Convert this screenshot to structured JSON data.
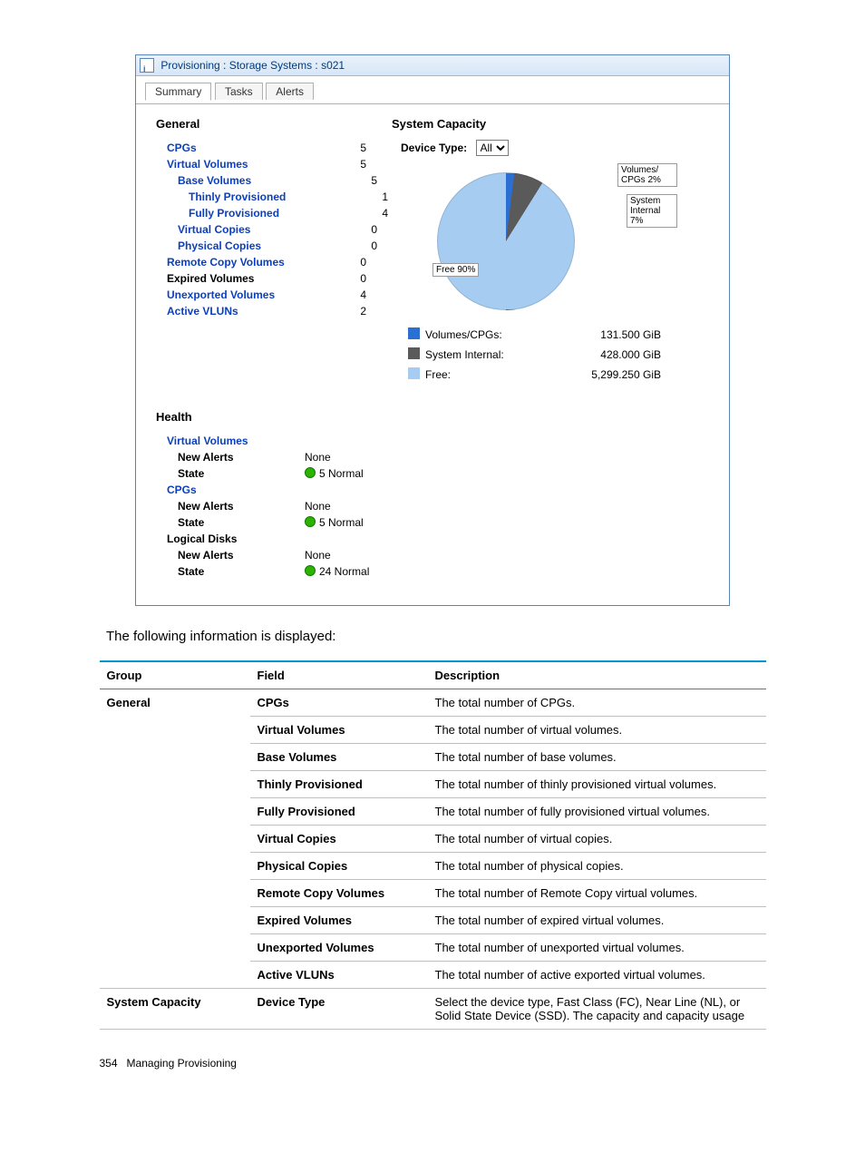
{
  "window": {
    "title": "Provisioning : Storage Systems : s021",
    "tabs": [
      "Summary",
      "Tasks",
      "Alerts"
    ],
    "active_tab": 0
  },
  "general": {
    "header": "General",
    "rows": [
      {
        "key": "cpgs",
        "label": "CPGs",
        "value": "5",
        "link": true,
        "indent": 0
      },
      {
        "key": "vv",
        "label": "Virtual Volumes",
        "value": "5",
        "link": true,
        "indent": 0
      },
      {
        "key": "bv",
        "label": "Base Volumes",
        "value": "5",
        "link": true,
        "indent": 1
      },
      {
        "key": "tp",
        "label": "Thinly Provisioned",
        "value": "1",
        "link": true,
        "indent": 2
      },
      {
        "key": "fp",
        "label": "Fully Provisioned",
        "value": "4",
        "link": true,
        "indent": 2
      },
      {
        "key": "vc",
        "label": "Virtual Copies",
        "value": "0",
        "link": true,
        "indent": 1
      },
      {
        "key": "pc",
        "label": "Physical Copies",
        "value": "0",
        "link": true,
        "indent": 1
      },
      {
        "key": "rcv",
        "label": "Remote Copy Volumes",
        "value": "0",
        "link": true,
        "indent": 0
      },
      {
        "key": "ev",
        "label": "Expired Volumes",
        "value": "0",
        "link": false,
        "indent": 0
      },
      {
        "key": "uv",
        "label": "Unexported Volumes",
        "value": "4",
        "link": true,
        "indent": 0
      },
      {
        "key": "av",
        "label": "Active VLUNs",
        "value": "2",
        "link": true,
        "indent": 0
      }
    ]
  },
  "capacity": {
    "header": "System Capacity",
    "device_type_label": "Device Type:",
    "device_type_value": "All",
    "callouts": {
      "free": "Free 90%",
      "volumes": "Volumes/\nCPGs 2%",
      "system": "System\nInternal\n7%"
    },
    "legend": [
      {
        "label": "Volumes/CPGs:",
        "value": "131.500 GiB",
        "sw": "sw-blue"
      },
      {
        "label": "System Internal:",
        "value": "428.000 GiB",
        "sw": "sw-gray"
      },
      {
        "label": "Free:",
        "value": "5,299.250 GiB",
        "sw": "sw-lblue"
      }
    ]
  },
  "chart_data": {
    "type": "pie",
    "title": "System Capacity",
    "slices": [
      {
        "name": "Volumes/CPGs",
        "percent": 2,
        "gib": 131.5
      },
      {
        "name": "System Internal",
        "percent": 7,
        "gib": 428.0
      },
      {
        "name": "Free",
        "percent": 90,
        "gib": 5299.25
      }
    ]
  },
  "health": {
    "header": "Health",
    "groups": [
      {
        "name": "Virtual Volumes",
        "link": true,
        "alerts": "None",
        "state": "5 Normal"
      },
      {
        "name": "CPGs",
        "link": true,
        "alerts": "None",
        "state": "5 Normal"
      },
      {
        "name": "Logical Disks",
        "link": false,
        "alerts": "None",
        "state": "24 Normal"
      }
    ],
    "labels": {
      "new_alerts": "New Alerts",
      "state": "State"
    }
  },
  "caption": "The following information is displayed:",
  "doc_headers": {
    "group": "Group",
    "field": "Field",
    "desc": "Description"
  },
  "doc_rows": [
    {
      "group": "General",
      "field": "CPGs",
      "desc": "The total number of CPGs."
    },
    {
      "group": "",
      "field": "Virtual Volumes",
      "desc": "The total number of virtual volumes."
    },
    {
      "group": "",
      "field": "Base Volumes",
      "desc": "The total number of base volumes."
    },
    {
      "group": "",
      "field": "Thinly Provisioned",
      "desc": "The total number of thinly provisioned virtual volumes."
    },
    {
      "group": "",
      "field": "Fully Provisioned",
      "desc": "The total number of fully provisioned virtual volumes."
    },
    {
      "group": "",
      "field": "Virtual Copies",
      "desc": "The total number of virtual copies."
    },
    {
      "group": "",
      "field": "Physical Copies",
      "desc": "The total number of physical copies."
    },
    {
      "group": "",
      "field": "Remote Copy Volumes",
      "desc": "The total number of Remote Copy virtual volumes."
    },
    {
      "group": "",
      "field": "Expired Volumes",
      "desc": "The total number of expired virtual volumes."
    },
    {
      "group": "",
      "field": "Unexported Volumes",
      "desc": "The total number of unexported virtual volumes."
    },
    {
      "group": "",
      "field": "Active VLUNs",
      "desc": "The total number of active exported virtual volumes."
    },
    {
      "group": "System Capacity",
      "field": "Device Type",
      "desc": "Select the device type, Fast Class (FC), Near Line (NL), or Solid State Device (SSD). The capacity and capacity usage"
    }
  ],
  "footer": {
    "page": "354",
    "section": "Managing Provisioning"
  }
}
